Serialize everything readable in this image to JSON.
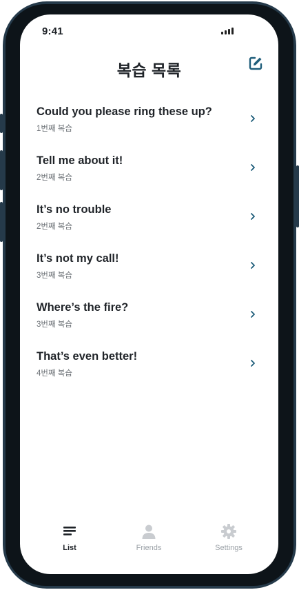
{
  "status_bar": {
    "time": "9:41"
  },
  "header": {
    "title": "복습 목록"
  },
  "review_items": [
    {
      "title": "Could you please ring these up?",
      "count": "1번째 복습"
    },
    {
      "title": "Tell me about it!",
      "count": "2번째 복습"
    },
    {
      "title": "It’s no trouble",
      "count": "2번째 복습"
    },
    {
      "title": "It’s not my call!",
      "count": "3번째 복습"
    },
    {
      "title": "Where’s the fire?",
      "count": "3번째 복습"
    },
    {
      "title": "That’s even better!",
      "count": "4번째 복습"
    }
  ],
  "bottom_nav": {
    "items": [
      {
        "label": "List",
        "icon": "list-icon",
        "active": true
      },
      {
        "label": "Friends",
        "icon": "person-icon",
        "active": false
      },
      {
        "label": "Settings",
        "icon": "gear-icon",
        "active": false
      }
    ]
  },
  "colors": {
    "text_primary": "#1f2328",
    "text_secondary": "#6b7075",
    "accent": "#1e5d7a",
    "nav_inactive": "#c9ccd0",
    "frame": "#0d1419"
  }
}
